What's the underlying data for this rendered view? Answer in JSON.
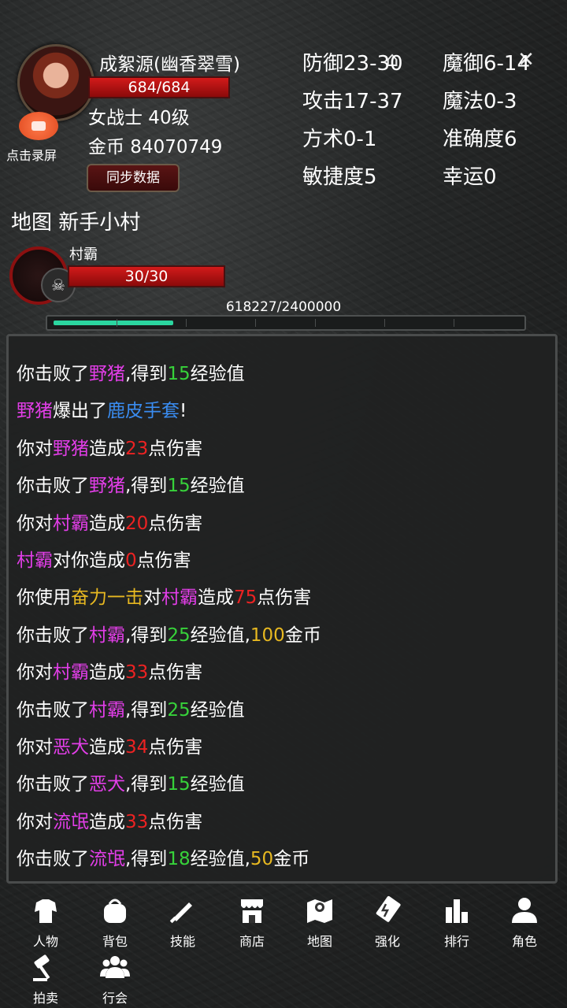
{
  "player": {
    "name": "成絮源(幽香翠雪)",
    "hp": "684/684",
    "class_level": "女战士 40级",
    "gold": "金币 84070749",
    "record_label": "点击录屏",
    "sync_label": "同步数据"
  },
  "stats": {
    "defense": "防御23-30",
    "magic_defense": "魔御6-14",
    "attack": "攻击17-37",
    "magic": "魔法0-3",
    "taoism": "方术0-1",
    "accuracy": "准确度6",
    "agility": "敏捷度5",
    "luck": "幸运0"
  },
  "map": {
    "label": "地图 新手小村"
  },
  "enemy": {
    "name": "村霸",
    "hp": "30/30"
  },
  "exp": {
    "text": "618227/2400000",
    "progress": 0.2576
  },
  "log": [
    [
      [
        "你击败了",
        "white"
      ],
      [
        "野猪",
        "magenta"
      ],
      [
        ",得到",
        "white"
      ],
      [
        "15",
        "green"
      ],
      [
        "经验值",
        "white"
      ]
    ],
    [
      [
        "野猪",
        "magenta"
      ],
      [
        "爆出了",
        "white"
      ],
      [
        "鹿皮手套",
        "blue"
      ],
      [
        "!",
        "white"
      ]
    ],
    [
      [
        "你对",
        "white"
      ],
      [
        "野猪",
        "magenta"
      ],
      [
        "造成",
        "white"
      ],
      [
        "23",
        "red"
      ],
      [
        "点伤害",
        "white"
      ]
    ],
    [
      [
        "你击败了",
        "white"
      ],
      [
        "野猪",
        "magenta"
      ],
      [
        ",得到",
        "white"
      ],
      [
        "15",
        "green"
      ],
      [
        "经验值",
        "white"
      ]
    ],
    [
      [
        "你对",
        "white"
      ],
      [
        "村霸",
        "magenta"
      ],
      [
        "造成",
        "white"
      ],
      [
        "20",
        "red"
      ],
      [
        "点伤害",
        "white"
      ]
    ],
    [
      [
        "村霸",
        "magenta"
      ],
      [
        "对你造成",
        "white"
      ],
      [
        "0",
        "red"
      ],
      [
        "点伤害",
        "white"
      ]
    ],
    [
      [
        "你使用",
        "white"
      ],
      [
        "奋力一击",
        "gold"
      ],
      [
        "对",
        "white"
      ],
      [
        "村霸",
        "magenta"
      ],
      [
        "造成",
        "white"
      ],
      [
        "75",
        "red"
      ],
      [
        "点伤害",
        "white"
      ]
    ],
    [
      [
        "你击败了",
        "white"
      ],
      [
        "村霸",
        "magenta"
      ],
      [
        ",得到",
        "white"
      ],
      [
        "25",
        "green"
      ],
      [
        "经验值,",
        "white"
      ],
      [
        "100",
        "gold"
      ],
      [
        "金币",
        "white"
      ]
    ],
    [
      [
        "你对",
        "white"
      ],
      [
        "村霸",
        "magenta"
      ],
      [
        "造成",
        "white"
      ],
      [
        "33",
        "red"
      ],
      [
        "点伤害",
        "white"
      ]
    ],
    [
      [
        "你击败了",
        "white"
      ],
      [
        "村霸",
        "magenta"
      ],
      [
        ",得到",
        "white"
      ],
      [
        "25",
        "green"
      ],
      [
        "经验值",
        "white"
      ]
    ],
    [
      [
        "你对",
        "white"
      ],
      [
        "恶犬",
        "magenta"
      ],
      [
        "造成",
        "white"
      ],
      [
        "34",
        "red"
      ],
      [
        "点伤害",
        "white"
      ]
    ],
    [
      [
        "你击败了",
        "white"
      ],
      [
        "恶犬",
        "magenta"
      ],
      [
        ",得到",
        "white"
      ],
      [
        "15",
        "green"
      ],
      [
        "经验值",
        "white"
      ]
    ],
    [
      [
        "你对",
        "white"
      ],
      [
        "流氓",
        "magenta"
      ],
      [
        "造成",
        "white"
      ],
      [
        "33",
        "red"
      ],
      [
        "点伤害",
        "white"
      ]
    ],
    [
      [
        "你击败了",
        "white"
      ],
      [
        "流氓",
        "magenta"
      ],
      [
        ",得到",
        "white"
      ],
      [
        "18",
        "green"
      ],
      [
        "经验值,",
        "white"
      ],
      [
        "50",
        "gold"
      ],
      [
        "金币",
        "white"
      ]
    ]
  ],
  "nav": [
    {
      "label": "人物",
      "icon": "character-icon"
    },
    {
      "label": "背包",
      "icon": "bag-icon"
    },
    {
      "label": "技能",
      "icon": "skills-icon"
    },
    {
      "label": "商店",
      "icon": "shop-icon"
    },
    {
      "label": "地图",
      "icon": "map-icon"
    },
    {
      "label": "强化",
      "icon": "enhance-icon"
    },
    {
      "label": "排行",
      "icon": "ranking-icon"
    },
    {
      "label": "角色",
      "icon": "role-icon"
    },
    {
      "label": "拍卖",
      "icon": "auction-icon"
    },
    {
      "label": "行会",
      "icon": "guild-icon"
    }
  ],
  "colors": {
    "white": "#ffffff",
    "magenta": "#e23ee8",
    "green": "#37d23a",
    "red": "#ec2222",
    "blue": "#3a8cf0",
    "gold": "#e7b821",
    "exp_fill": "#2bd6a0"
  }
}
